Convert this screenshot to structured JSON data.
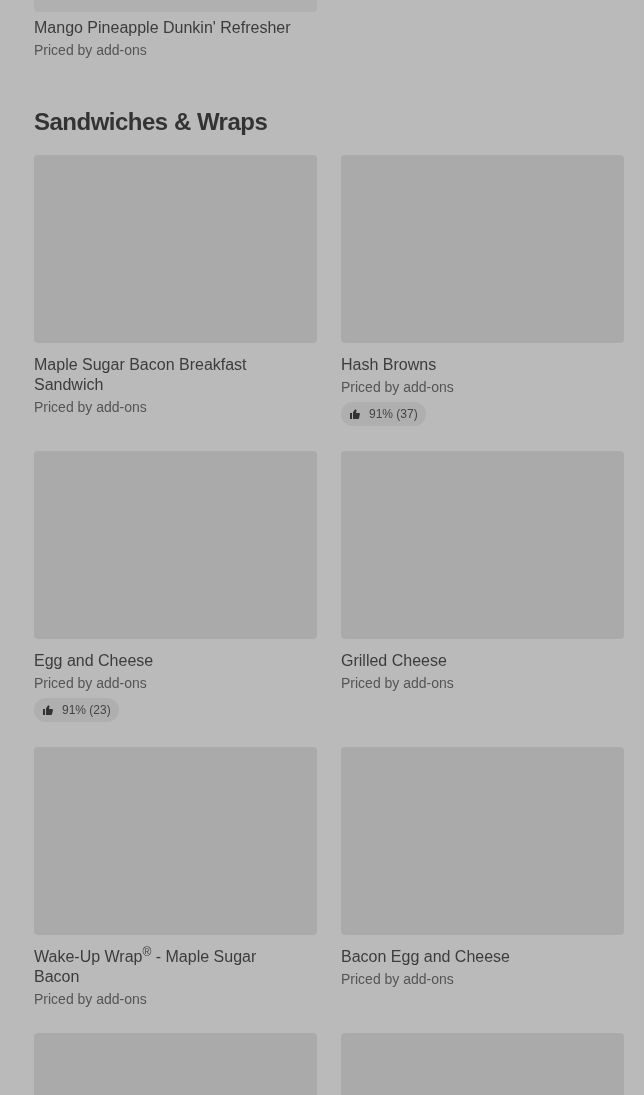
{
  "previous_item": {
    "name": "Mango Pineapple Dunkin' Refresher",
    "subtitle": "Priced by add-ons"
  },
  "section": {
    "title": "Sandwiches & Wraps",
    "items": [
      {
        "kind": "item",
        "name": "Maple Sugar Bacon Breakfast Sandwich",
        "subtitle": "Priced by add-ons"
      },
      {
        "kind": "item",
        "name": "Hash Browns",
        "subtitle": "Priced by add-ons",
        "rating": "91% (37)"
      },
      {
        "kind": "item",
        "name": "Egg and Cheese",
        "subtitle": "Priced by add-ons",
        "rating": "91% (23)"
      },
      {
        "kind": "item",
        "name": "Grilled Cheese",
        "subtitle": "Priced by add-ons"
      },
      {
        "kind": "item",
        "name": "Wake-Up Wrap$^{®}$ - Maple Sugar Bacon",
        "subtitle": "Priced by add-ons"
      },
      {
        "kind": "item",
        "name": "Bacon Egg and Cheese",
        "subtitle": "Priced by add-ons"
      },
      {
        "kind": "image_only"
      },
      {
        "kind": "image_only"
      }
    ]
  }
}
